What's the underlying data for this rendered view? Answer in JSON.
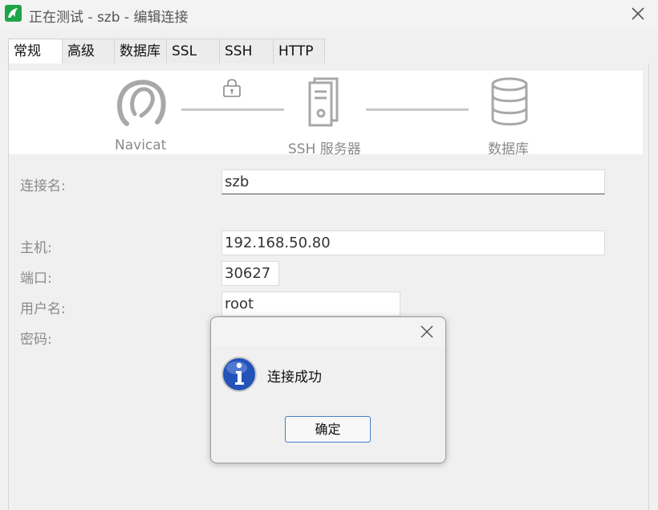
{
  "window": {
    "title": "正在测试 - szb - 编辑连接"
  },
  "tabs": [
    {
      "label": "常规",
      "active": true
    },
    {
      "label": "高级"
    },
    {
      "label": "数据库"
    },
    {
      "label": "SSL"
    },
    {
      "label": "SSH"
    },
    {
      "label": "HTTP"
    }
  ],
  "diagram": {
    "nodes": [
      {
        "label": "Navicat",
        "icon": "navicat-logo-icon"
      },
      {
        "label": "SSH 服务器",
        "icon": "server-icon"
      },
      {
        "label": "数据库",
        "icon": "database-icon"
      }
    ],
    "lock_icon": "lock-icon"
  },
  "form": {
    "connection_name_label": "连接名:",
    "connection_name_value": "szb",
    "host_label": "主机:",
    "host_value": "192.168.50.80",
    "port_label": "端口:",
    "port_value": "30627",
    "username_label": "用户名:",
    "username_value": "root",
    "password_label": "密码:"
  },
  "dialog": {
    "message": "连接成功",
    "ok_label": "确定",
    "icon": "info-icon"
  },
  "colors": {
    "accent": "#3d7fc7",
    "app_icon": "#1fa44a"
  }
}
